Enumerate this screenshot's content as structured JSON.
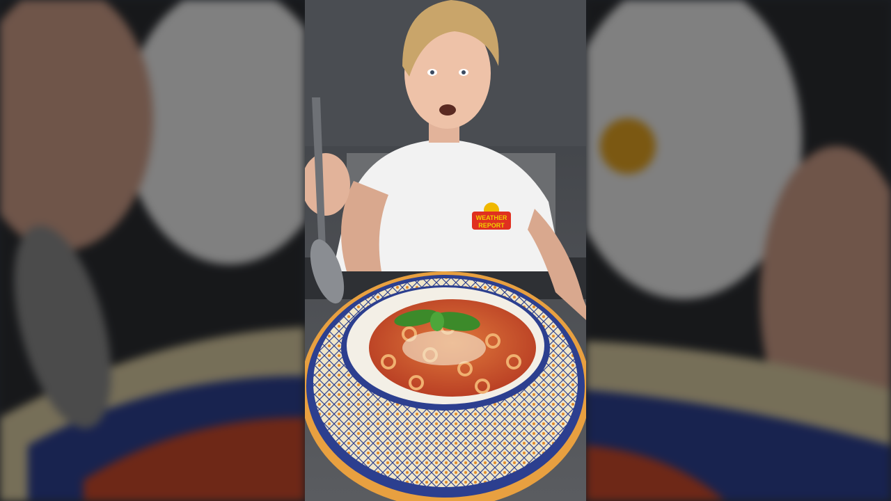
{
  "video": {
    "shirt_logo_text_line1": "WEATHER",
    "shirt_logo_text_line2": "REPORT"
  },
  "colors": {
    "background": "#1a1d22",
    "shirt": "#f2f2f2",
    "sauce": "#c8482a",
    "plate_blue": "#2c3f8f",
    "plate_orange": "#e08a2c",
    "basil": "#3c8a2a"
  },
  "icons": [
    "spoon-icon",
    "basil-leaf-icon"
  ]
}
